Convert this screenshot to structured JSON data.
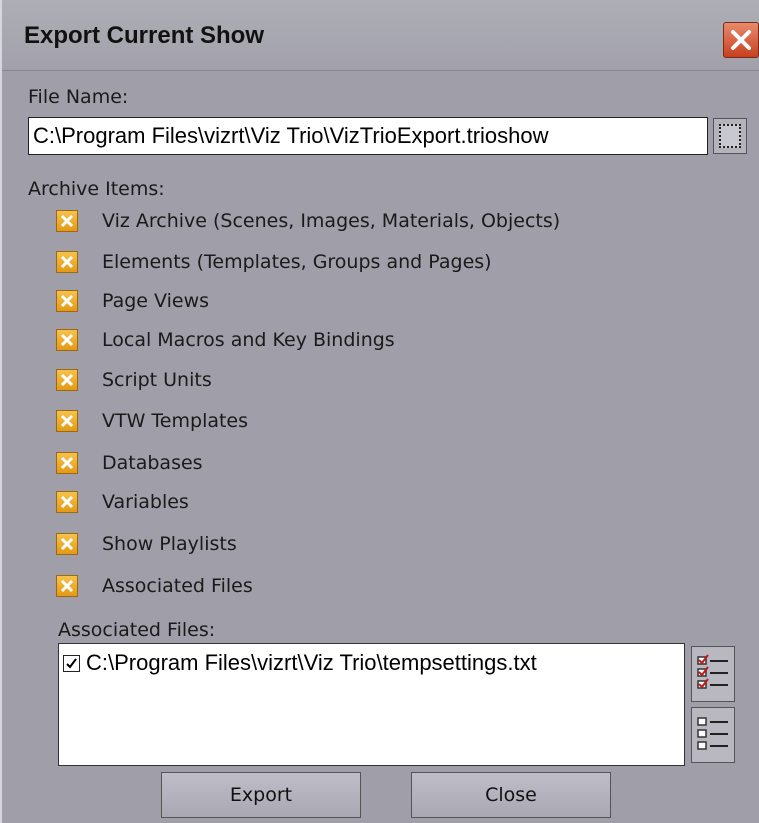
{
  "window": {
    "title": "Export Current Show"
  },
  "file_name": {
    "label": "File Name:",
    "value": "C:\\Program Files\\vizrt\\Viz Trio\\VizTrioExport.trioshow"
  },
  "archive_items": {
    "label": "Archive Items:",
    "items": [
      {
        "label": "Viz Archive (Scenes, Images, Materials, Objects)",
        "checked": true
      },
      {
        "label": "Elements (Templates, Groups and Pages)",
        "checked": true
      },
      {
        "label": "Page Views",
        "checked": true
      },
      {
        "label": "Local Macros and Key Bindings",
        "checked": true
      },
      {
        "label": "Script Units",
        "checked": true
      },
      {
        "label": "VTW Templates",
        "checked": true
      },
      {
        "label": "Databases",
        "checked": true
      },
      {
        "label": "Variables",
        "checked": true
      },
      {
        "label": "Show Playlists",
        "checked": true
      },
      {
        "label": "Associated Files",
        "checked": true
      }
    ]
  },
  "associated_files": {
    "label": "Associated Files:",
    "files": [
      {
        "path": "C:\\Program Files\\vizrt\\Viz Trio\\tempsettings.txt",
        "checked": true
      }
    ]
  },
  "buttons": {
    "export": "Export",
    "close": "Close"
  },
  "colors": {
    "dialog_bg": "#a09fa9",
    "checkbox_accent": "#f0b030",
    "close_button": "#d9552f"
  },
  "icons": {
    "close": "close-icon",
    "browse": "browse-icon",
    "select_all": "check-all-list-icon",
    "select_none": "uncheck-all-list-icon"
  }
}
